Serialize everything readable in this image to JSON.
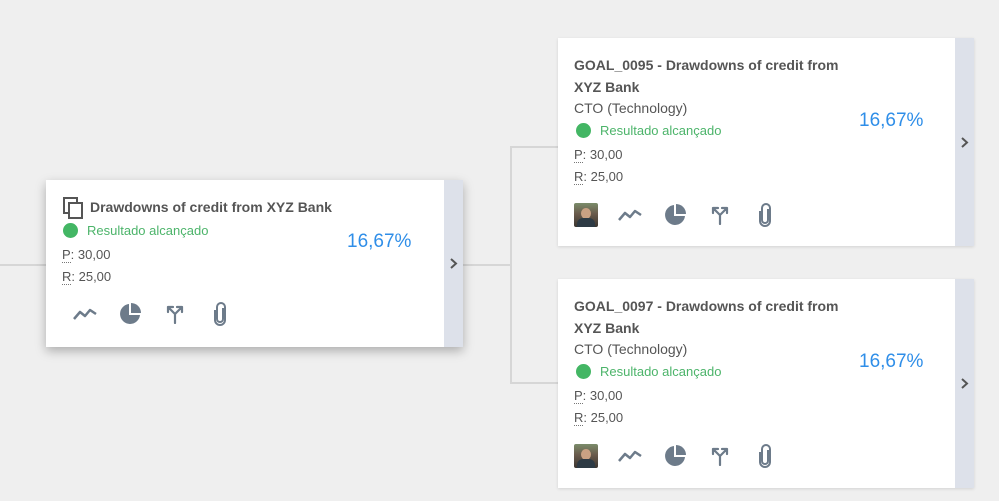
{
  "main_card": {
    "title": "Drawdowns of credit from XYZ Bank",
    "status": "Resultado alcançado",
    "planned_label": "P",
    "planned_value": ": 30,00",
    "realized_label": "R",
    "realized_value": ": 25,00",
    "percent": "16,67%"
  },
  "child_cards": [
    {
      "title_line1": "GOAL_0095 - Drawdowns of credit from",
      "title_line2": "XYZ Bank",
      "owner": "CTO (Technology)",
      "status": "Resultado alcançado",
      "planned_label": "P",
      "planned_value": ": 30,00",
      "realized_label": "R",
      "realized_value": ": 25,00",
      "percent": "16,67%"
    },
    {
      "title_line1": "GOAL_0097 - Drawdowns of credit from",
      "title_line2": "XYZ Bank",
      "owner": "CTO (Technology)",
      "status": "Resultado alcançado",
      "planned_label": "P",
      "planned_value": ": 30,00",
      "realized_label": "R",
      "realized_value": ": 25,00",
      "percent": "16,67%"
    }
  ],
  "icons": [
    "copy-icon",
    "trend-line-icon",
    "pie-chart-icon",
    "branch-icon",
    "paperclip-icon",
    "chevron-right-icon",
    "avatar"
  ],
  "colors": {
    "status_green": "#43b664",
    "percent_blue": "#2f8ee8",
    "icon_gray": "#6d7b8a",
    "expand_bar": "#dde1ea",
    "background": "#efefef"
  }
}
